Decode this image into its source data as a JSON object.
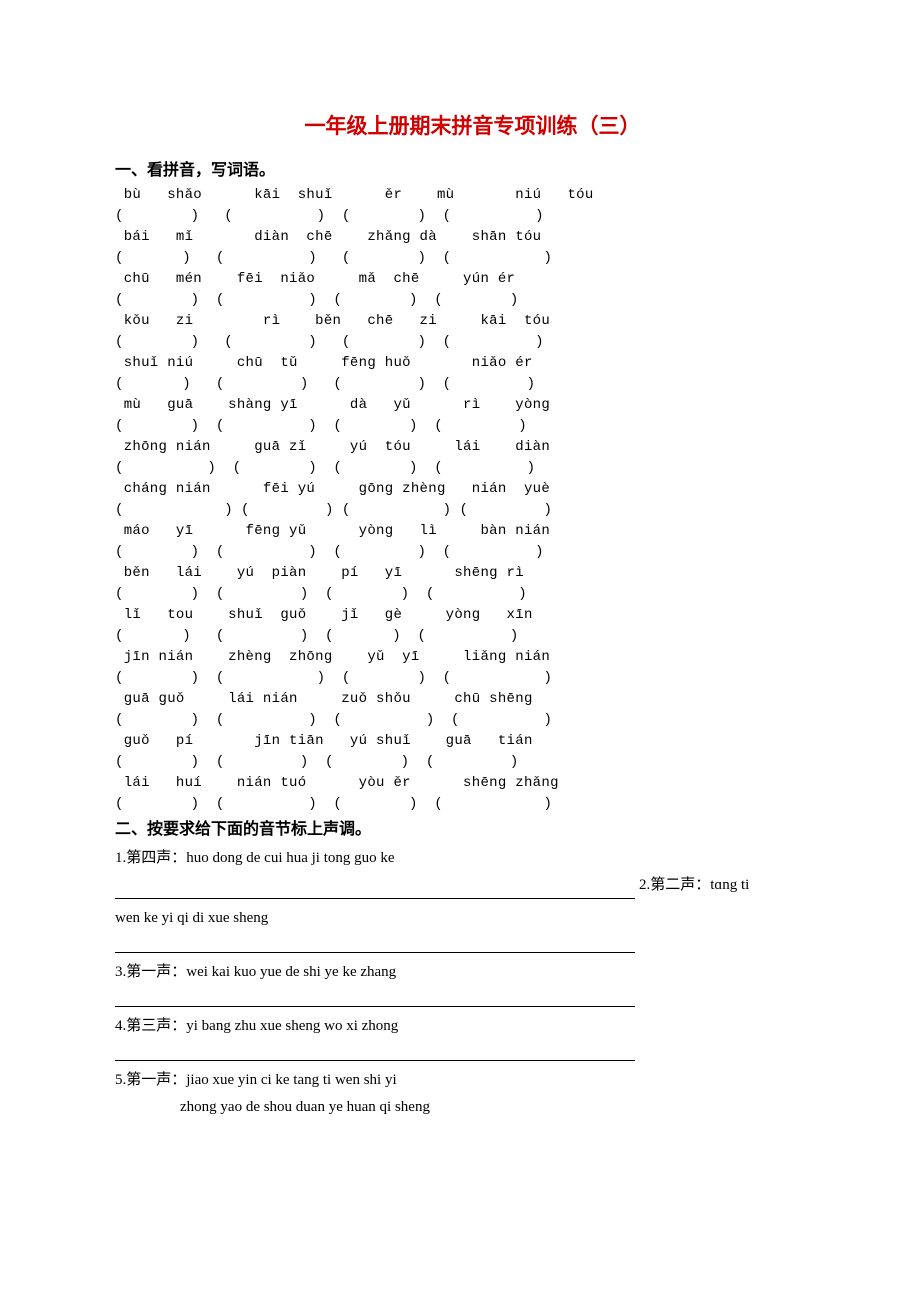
{
  "title": "一年级上册期末拼音专项训练（三）",
  "section1": {
    "heading": "一、看拼音，写词语。",
    "rows": [
      {
        "pinyin": "bù   shǎo      kāi  shuǐ      ěr    mù       niú   tóu",
        "paren": "(        )   (          )  (        )  (          )"
      },
      {
        "pinyin": "bái   mǐ       diàn  chē    zhǎng dà    shān tóu",
        "paren": "(       )   (          )   (        )  (           )"
      },
      {
        "pinyin": "chū   mén    fēi  niǎo     mǎ  chē     yún ér",
        "paren": "(        )  (          )  (        )  (        )"
      },
      {
        "pinyin": "kǒu   zi        rì    běn   chē   zi     kāi  tóu",
        "paren": "(        )   (         )   (        )  (          )"
      },
      {
        "pinyin": "shuǐ niú     chū  tǔ     fēng huǒ       niǎo ér",
        "paren": "(       )   (         )   (         )  (         )"
      },
      {
        "pinyin": "mù   guā    shàng yī      dà   yǔ      rì    yòng",
        "paren": "(        )  (          )  (        )  (         )"
      },
      {
        "pinyin": "zhōng nián     guā zǐ     yú  tóu     lái    diàn",
        "paren": "(          )  (        )  (        )  (          )"
      },
      {
        "pinyin": "cháng nián      fēi yú     gōng zhèng   nián  yuè",
        "paren": "(            ) (         ) (           ) (         )"
      },
      {
        "pinyin": "máo   yī      fēng yǔ      yòng   lì     bàn nián",
        "paren": "(        )  (          )  (         )  (          )"
      },
      {
        "pinyin": "běn   lái    yú  piàn    pí   yī      shēng rì",
        "paren": "(        )  (         )  (        )  (          )"
      },
      {
        "pinyin": "lǐ   tou    shuǐ  guǒ    jǐ   gè     yòng   xīn",
        "paren": "(       )   (         )  (       )  (          )"
      },
      {
        "pinyin": "jīn nián    zhèng  zhōng    yǔ  yī     liǎng nián",
        "paren": "(        )  (           )  (        )  (           )"
      },
      {
        "pinyin": "guā guǒ     lái nián     zuǒ shǒu     chū shēng",
        "paren": "(        )  (          )  (          )  (          )"
      },
      {
        "pinyin": "guǒ   pí       jīn tiān   yú shuǐ    guā   tián",
        "paren": "(        )  (         )  (        )  (         )"
      },
      {
        "pinyin": "lái   huí    nián tuó      yòu ěr      shēng zhǎng",
        "paren": "(        )  (          )  (        )  (            )"
      }
    ]
  },
  "section2": {
    "heading": "二、按要求给下面的音节标上声调。",
    "q1": "1.第四声：huo dong de cui hua ji tong guo ke",
    "q2_right": "2.第二声：tɑng ti",
    "q2_line2": "wen   ke yi qi di xue sheng",
    "q3": "3.第一声：wei kai kuo yue de shi ye ke zhang",
    "q4": "4.第三声：yi bang zhu xue sheng  wo xi zhong",
    "q5_line1": "5.第一声：jiao xue   yin ci   ke tang ti wen shi yi",
    "q5_line2": "zhong yao de shou duan ye huan qi sheng"
  }
}
